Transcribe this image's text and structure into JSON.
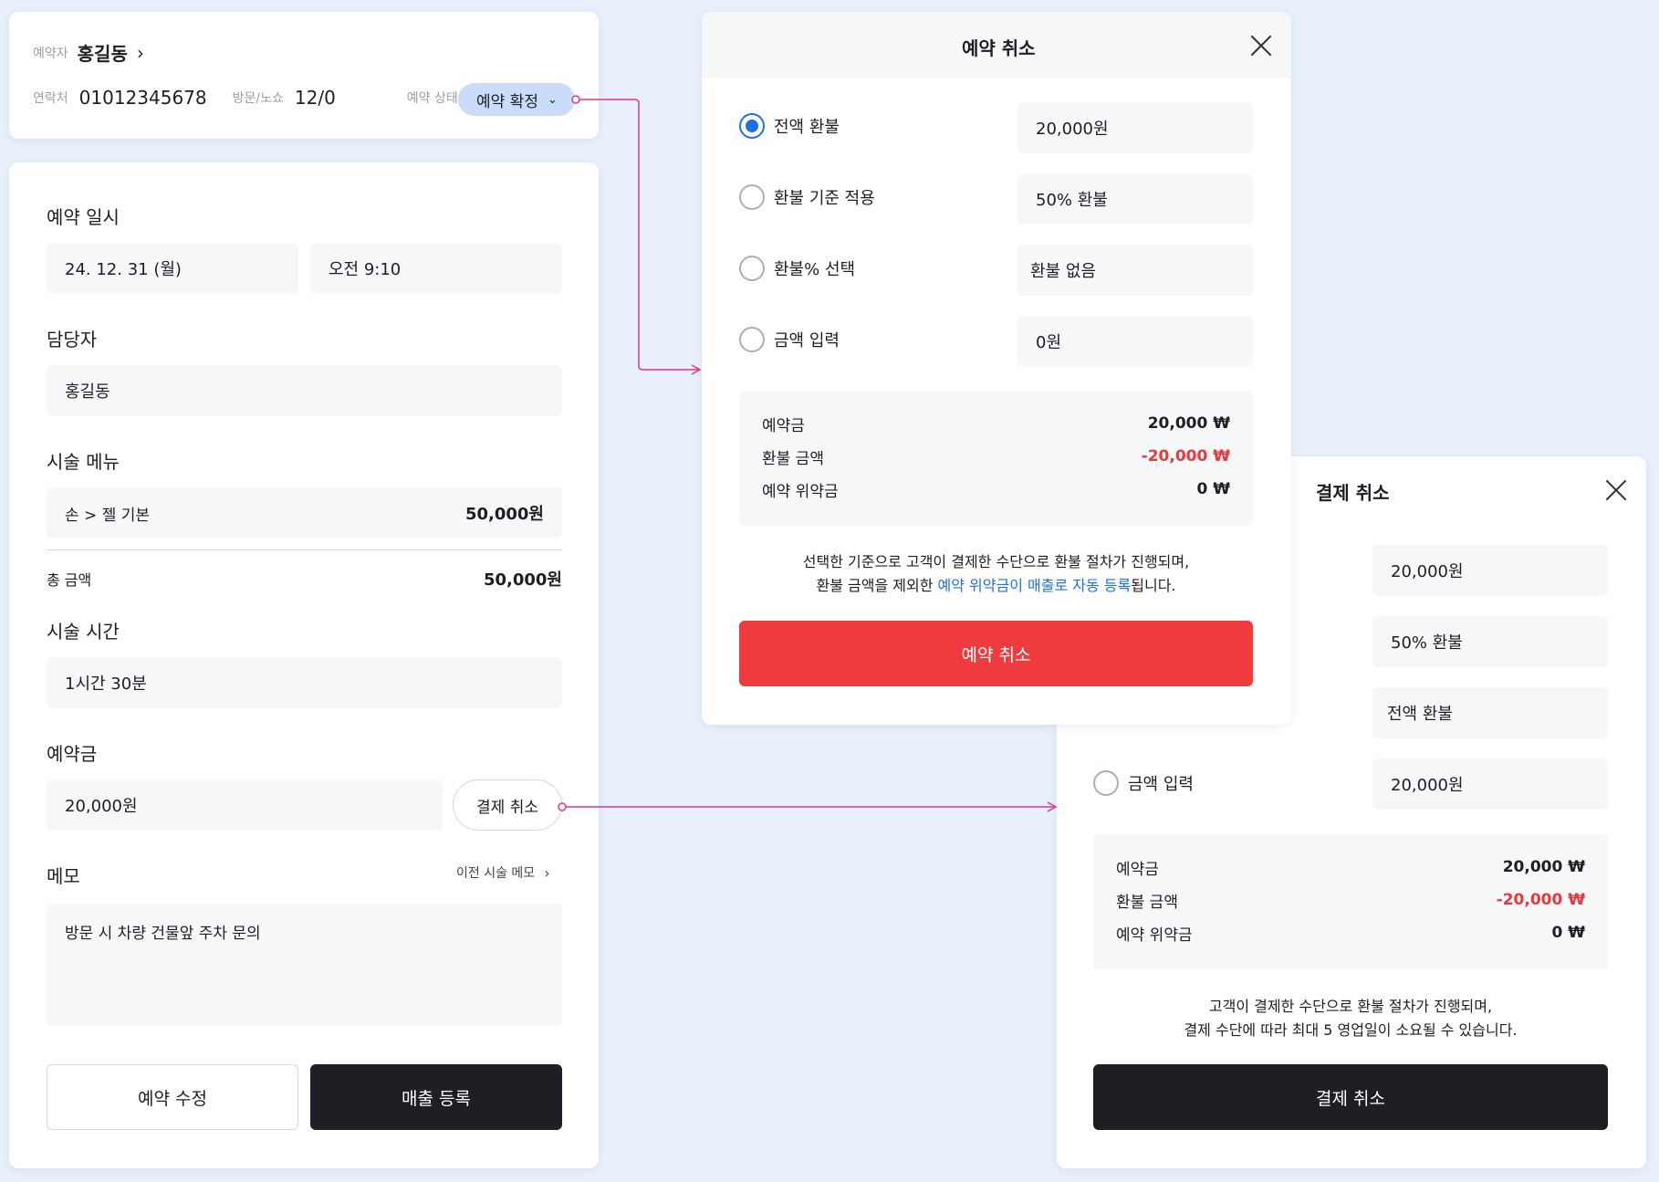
{
  "header_card": {
    "reserver_label": "예약자",
    "reserver_name": "홍길동",
    "contact_label": "연락처",
    "contact_value": "01012345678",
    "visit_label": "방문/노쇼",
    "visit_value": "12/0",
    "status_label": "예약 상태",
    "status_value": "예약 확정"
  },
  "detail_card": {
    "datetime_title": "예약 일시",
    "date_value": "24. 12. 31 (월)",
    "time_value": "오전 9:10",
    "staff_title": "담당자",
    "staff_value": "홍길동",
    "menu_title": "시술 메뉴",
    "menu_item_name": "손 > 젤 기본",
    "menu_item_price": "50,000원",
    "total_label": "총 금액",
    "total_value": "50,000원",
    "duration_title": "시술 시간",
    "duration_value": "1시간 30분",
    "deposit_title": "예약금",
    "deposit_value": "20,000원",
    "payment_cancel_button": "결제 취소",
    "memo_title": "메모",
    "prev_memo_link": "이전 시술 메모",
    "memo_value": "방문 시 차량 건물앞 주차 문의",
    "edit_button": "예약 수정",
    "sales_button": "매출 등록"
  },
  "reservation_cancel_modal": {
    "title": "예약 취소",
    "options": [
      {
        "label": "전액 환불",
        "value": "20,000원",
        "selected": true
      },
      {
        "label": "환불 기준 적용",
        "value": "50% 환불",
        "selected": false
      },
      {
        "label": "환불% 선택",
        "value": "환불 없음",
        "selected": false
      },
      {
        "label": "금액 입력",
        "value": "0원",
        "selected": false
      }
    ],
    "summary": {
      "deposit_label": "예약금",
      "deposit_value": "20,000 ₩",
      "refund_label": "환불 금액",
      "refund_value": "-20,000 ₩",
      "penalty_label": "예약 위약금",
      "penalty_value": "0 ₩"
    },
    "notice_line1": "선택한 기준으로 고객이 결제한 수단으로 환불 절차가 진행되며,",
    "notice_line2_pre": "환불 금액을 제외한 ",
    "notice_line2_link": "예약 위약금이 매출로 자동 등록",
    "notice_line2_post": "됩니다.",
    "confirm_button": "예약 취소",
    "accent_color": "#ef3b3e",
    "link_color": "#1f6fe8"
  },
  "payment_cancel_modal": {
    "title": "결제 취소",
    "options": [
      {
        "label": "",
        "value": "20,000원"
      },
      {
        "label": "",
        "value": "50% 환불"
      },
      {
        "label": "",
        "value": "전액 환불"
      },
      {
        "label": "금액 입력",
        "value": "20,000원"
      }
    ],
    "summary": {
      "deposit_label": "예약금",
      "deposit_value": "20,000 ₩",
      "refund_label": "환불 금액",
      "refund_value": "-20,000 ₩",
      "penalty_label": "예약 위약금",
      "penalty_value": "0 ₩"
    },
    "notice_line1": "고객이 결제한 수단으로 환불 절차가 진행되며,",
    "notice_line2": "결제 수단에 따라 최대 5 영업일이 소요될 수 있습니다.",
    "confirm_button": "결제 취소",
    "accent_color": "#1d1f24"
  },
  "connector_color": "#e8348a"
}
